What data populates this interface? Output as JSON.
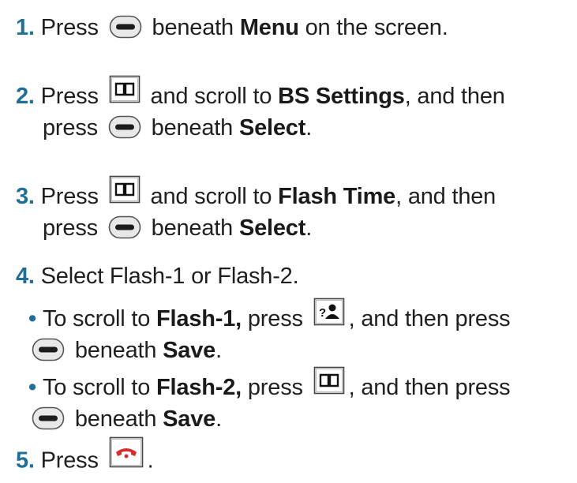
{
  "steps": [
    {
      "number": "1.",
      "lines": [
        [
          "Press",
          "beneath",
          "Menu",
          "on the screen."
        ]
      ]
    },
    {
      "number": "2.",
      "line1": {
        "a": "Press",
        "b": "and scroll to",
        "bold": "BS Settings",
        "c": ", and then"
      },
      "line2": {
        "a": "press",
        "b": "beneath",
        "bold": "Select",
        "c": "."
      }
    },
    {
      "number": "3.",
      "line1": {
        "a": "Press",
        "b": "and scroll to",
        "bold": "Flash Time",
        "c": ", and then"
      },
      "line2": {
        "a": "press",
        "b": "beneath",
        "bold": "Select",
        "c": "."
      }
    },
    {
      "number": "4.",
      "text": "Select Flash-1 or Flash-2."
    },
    {
      "number": "5.",
      "text": "Press",
      "end": "."
    }
  ],
  "step1": {
    "press": "Press",
    "beneath": "beneath",
    "menu": "Menu",
    "rest": "on the screen."
  },
  "bullets": [
    {
      "bullet": "•",
      "a": "To scroll to",
      "bold": "Flash-1,",
      "b": "press",
      "c": ", and then press",
      "d": "beneath",
      "bold2": "Save",
      "e": ".",
      "key_icon": "contact-key-icon"
    },
    {
      "bullet": "•",
      "a": "To scroll to",
      "bold": "Flash-2,",
      "b": "press",
      "c": ", and then press",
      "d": "beneath",
      "bold2": "Save",
      "e": ".",
      "key_icon": "phonebook-key-icon"
    }
  ],
  "icons": {
    "soft_key": "soft-key-icon",
    "phonebook_key": "phonebook-key-icon",
    "contact_key": "contact-key-icon",
    "end_call_key": "end-call-key-icon"
  },
  "colors": {
    "step_number": "#1f6f96",
    "text": "#1f1f1f",
    "end_call": "#d32f2f"
  }
}
